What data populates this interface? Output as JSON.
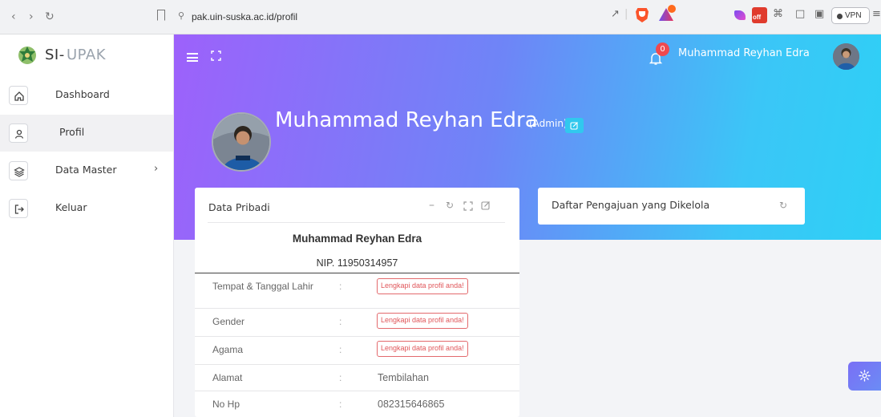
{
  "browser": {
    "url": "pak.uin-suska.ac.id/profil",
    "vpn_label": "VPN",
    "ext_badge": "off"
  },
  "sidebar": {
    "brand_prefix": "SI-",
    "brand_suffix": "UPAK",
    "items": [
      {
        "label": "Dashboard",
        "icon": "home-icon"
      },
      {
        "label": "Profil",
        "icon": "user-icon",
        "active": true
      },
      {
        "label": "Data Master",
        "icon": "layers-icon",
        "chevron": "›"
      },
      {
        "label": "Keluar",
        "icon": "logout-icon"
      }
    ]
  },
  "topbar": {
    "notification_count": "0",
    "user_name": "Muhammad Reyhan Edra"
  },
  "profile": {
    "name": "Muhammad Reyhan Edra",
    "role": "(Admin)"
  },
  "data_pribadi": {
    "title": "Data Pribadi",
    "name": "Muhammad Reyhan Edra",
    "nip": "NIP. 11950314957",
    "colon": ":",
    "rows": [
      {
        "label": "Tempat & Tanggal Lahir",
        "value": "",
        "warning": "Lengkapi data profil anda!"
      },
      {
        "label": "Gender",
        "value": "",
        "warning": "Lengkapi data profil anda!"
      },
      {
        "label": "Agama",
        "value": "",
        "warning": "Lengkapi data profil anda!"
      },
      {
        "label": "Alamat",
        "value": "Tembilahan",
        "warning": ""
      },
      {
        "label": "No Hp",
        "value": "082315646865",
        "warning": ""
      }
    ]
  },
  "pengajuan": {
    "title": "Daftar Pengajuan yang Dikelola"
  },
  "colors": {
    "gradient_start": "#9d61fb",
    "gradient_end": "#2ed0f5",
    "warning_red": "#e36a6d",
    "edit_badge": "#31c8ee"
  }
}
